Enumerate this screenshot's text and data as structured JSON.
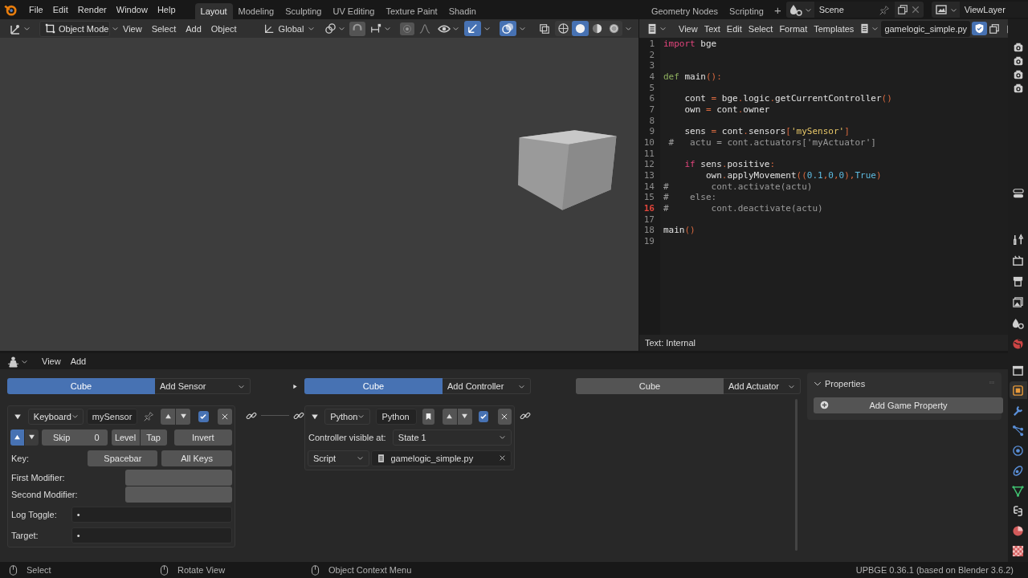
{
  "menubar": {
    "menus": [
      "File",
      "Edit",
      "Render",
      "Window",
      "Help"
    ],
    "workspaces": [
      {
        "label": "Layout",
        "selected": true
      },
      {
        "label": "Modeling",
        "selected": false
      },
      {
        "label": "Sculpting",
        "selected": false
      },
      {
        "label": "UV Editing",
        "selected": false
      },
      {
        "label": "Texture Paint",
        "selected": false
      },
      {
        "label": "Shadin",
        "selected": false
      },
      {
        "label": "Geometry Nodes",
        "selected": false
      },
      {
        "label": "Scripting",
        "selected": false
      }
    ],
    "add_workspace": "+",
    "scene": "Scene",
    "view_layer": "ViewLayer"
  },
  "viewport": {
    "mode": "Object Mode",
    "menus": [
      "View",
      "Select",
      "Add",
      "Object"
    ],
    "orientation": "Global",
    "gizmos_on": true,
    "overlays_on": true,
    "xray_on": false,
    "shading": [
      {
        "kind": "wireframe",
        "selected": false
      },
      {
        "kind": "solid",
        "selected": true
      },
      {
        "kind": "material",
        "selected": false
      },
      {
        "kind": "rendered",
        "selected": false
      }
    ]
  },
  "text_editor": {
    "menus": [
      "View",
      "Text",
      "Edit",
      "Select",
      "Format",
      "Templates"
    ],
    "file": "gamelogic_simple.py",
    "footer": "Text: Internal",
    "lines": [
      {
        "number": "1",
        "current": false,
        "tokens": [
          {
            "kind": "keyword",
            "text": "import"
          },
          {
            "kind": "plain",
            "text": " bge"
          }
        ]
      },
      {
        "number": "2",
        "current": false
      },
      {
        "number": "3",
        "current": false
      },
      {
        "number": "4",
        "current": false,
        "tokens": [
          {
            "kind": "reserved",
            "text": "def"
          },
          {
            "kind": "plain",
            "text": " main"
          },
          {
            "kind": "punct",
            "text": "():"
          }
        ]
      },
      {
        "number": "5",
        "current": false
      },
      {
        "number": "6",
        "current": false,
        "tokens": [
          {
            "kind": "plain",
            "text": "    cont "
          },
          {
            "kind": "punct",
            "text": "="
          },
          {
            "kind": "plain",
            "text": " bge"
          },
          {
            "kind": "punct",
            "text": "."
          },
          {
            "kind": "plain",
            "text": "logic"
          },
          {
            "kind": "punct",
            "text": "."
          },
          {
            "kind": "plain",
            "text": "getCurrentController"
          },
          {
            "kind": "punct",
            "text": "()"
          }
        ]
      },
      {
        "number": "7",
        "current": false,
        "tokens": [
          {
            "kind": "plain",
            "text": "    own "
          },
          {
            "kind": "punct",
            "text": "="
          },
          {
            "kind": "plain",
            "text": " cont"
          },
          {
            "kind": "punct",
            "text": "."
          },
          {
            "kind": "plain",
            "text": "owner"
          }
        ]
      },
      {
        "number": "8",
        "current": false
      },
      {
        "number": "9",
        "current": false,
        "tokens": [
          {
            "kind": "plain",
            "text": "    sens "
          },
          {
            "kind": "punct",
            "text": "="
          },
          {
            "kind": "plain",
            "text": " cont"
          },
          {
            "kind": "punct",
            "text": "."
          },
          {
            "kind": "plain",
            "text": "sensors"
          },
          {
            "kind": "punct",
            "text": "["
          },
          {
            "kind": "string",
            "text": "'mySensor'"
          },
          {
            "kind": "punct",
            "text": "]"
          }
        ]
      },
      {
        "number": "10",
        "current": false,
        "tokens": [
          {
            "kind": "comment",
            "text": " #   actu = cont.actuators['myActuator']"
          }
        ]
      },
      {
        "number": "11",
        "current": false
      },
      {
        "number": "12",
        "current": false,
        "tokens": [
          {
            "kind": "keyword",
            "text": "    if"
          },
          {
            "kind": "plain",
            "text": " sens"
          },
          {
            "kind": "punct",
            "text": "."
          },
          {
            "kind": "plain",
            "text": "positive"
          },
          {
            "kind": "punct",
            "text": ":"
          }
        ]
      },
      {
        "number": "13",
        "current": false,
        "tokens": [
          {
            "kind": "plain",
            "text": "        own"
          },
          {
            "kind": "punct",
            "text": "."
          },
          {
            "kind": "plain",
            "text": "applyMovement"
          },
          {
            "kind": "punct",
            "text": "(("
          },
          {
            "kind": "number",
            "text": "0.1"
          },
          {
            "kind": "punct",
            "text": ","
          },
          {
            "kind": "number",
            "text": "0"
          },
          {
            "kind": "punct",
            "text": ","
          },
          {
            "kind": "number",
            "text": "0"
          },
          {
            "kind": "punct",
            "text": "),"
          },
          {
            "kind": "number",
            "text": "True"
          },
          {
            "kind": "punct",
            "text": ")"
          }
        ]
      },
      {
        "number": "14",
        "current": false,
        "tokens": [
          {
            "kind": "comment",
            "text": "#        cont.activate(actu)"
          }
        ]
      },
      {
        "number": "15",
        "current": false,
        "tokens": [
          {
            "kind": "comment",
            "text": "#    else:"
          }
        ]
      },
      {
        "number": "16",
        "current": true,
        "tokens": [
          {
            "kind": "comment",
            "text": "#        cont.deactivate(actu)"
          }
        ]
      },
      {
        "number": "17",
        "current": false
      },
      {
        "number": "18",
        "current": false,
        "tokens": [
          {
            "kind": "plain",
            "text": "main"
          },
          {
            "kind": "punct",
            "text": "()"
          }
        ]
      },
      {
        "number": "19",
        "current": false
      }
    ]
  },
  "logic_editor": {
    "menus": [
      "View",
      "Add"
    ],
    "sensors": {
      "object": {
        "label": "Cube",
        "selected": true
      },
      "add_menu": "Add Sensor",
      "sensor": {
        "type": "Keyboard",
        "name": "mySensor",
        "expanded": true,
        "active": true,
        "pulse_true": true,
        "pulse_false": false,
        "skip_label": "Skip",
        "skip": "0",
        "level": {
          "label": "Level",
          "selected": false
        },
        "tap": {
          "label": "Tap",
          "selected": false
        },
        "invert": {
          "label": "Invert",
          "selected": false
        },
        "key_label": "Key:",
        "key": "Spacebar",
        "all_keys": "All Keys",
        "first_modifier_label": "First Modifier:",
        "second_modifier_label": "Second Modifier:",
        "log_toggle_label": "Log Toggle:",
        "log_toggle": "•",
        "target_label": "Target:",
        "target": "•"
      }
    },
    "controllers": {
      "object": {
        "label": "Cube",
        "selected": true
      },
      "add_menu": "Add Controller",
      "controller": {
        "type": "Python",
        "name": "Python",
        "expanded": true,
        "active": true,
        "visible_label": "Controller visible at:",
        "state": "State 1",
        "mode": "Script",
        "script": "gamelogic_simple.py"
      }
    },
    "actuators": {
      "object": {
        "label": "Cube",
        "selected": false
      },
      "add_menu": "Add Actuator"
    },
    "properties": {
      "title": "Properties",
      "expanded": true,
      "add_button": "Add Game Property"
    }
  },
  "side_tabs": [
    {
      "kind": "tool",
      "selected": false
    },
    {
      "kind": "object",
      "selected": true
    },
    {
      "kind": "modifiers",
      "selected": false
    },
    {
      "kind": "particles",
      "selected": false
    },
    {
      "kind": "physics",
      "selected": false
    },
    {
      "kind": "constraints",
      "selected": false
    },
    {
      "kind": "data",
      "selected": false
    },
    {
      "kind": "python",
      "selected": false
    },
    {
      "kind": "material",
      "selected": false
    },
    {
      "kind": "texture",
      "selected": false
    }
  ],
  "status_bar": {
    "hints": [
      "Select",
      "Rotate View",
      "Object Context Menu"
    ],
    "version": "UPBGE 0.36.1 (based on Blender 3.6.2)"
  }
}
